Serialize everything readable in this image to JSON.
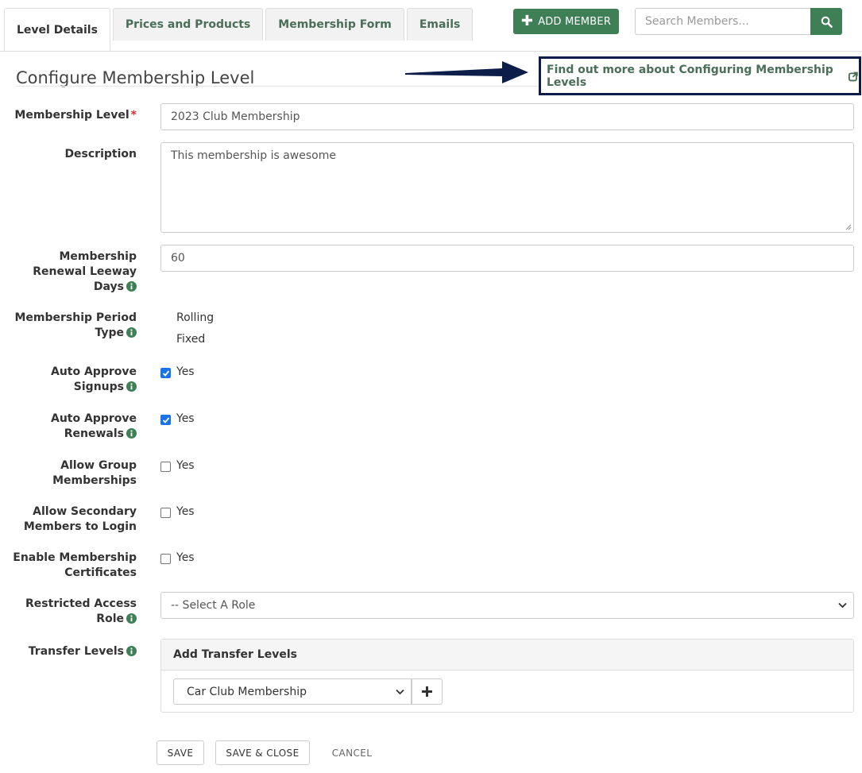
{
  "tabs": [
    {
      "label": "Level Details",
      "active": true
    },
    {
      "label": "Prices and Products"
    },
    {
      "label": "Membership Form"
    },
    {
      "label": "Emails"
    }
  ],
  "header": {
    "add_member_label": "ADD MEMBER",
    "search_placeholder": "Search Members..."
  },
  "page": {
    "title": "Configure Membership Level",
    "help_link": "Find out more about Configuring Membership Levels"
  },
  "form": {
    "membership_level": {
      "label": "Membership Level",
      "required_mark": "*",
      "value": "2023 Club Membership"
    },
    "description": {
      "label": "Description",
      "value": "This membership is awesome"
    },
    "renewal_leeway": {
      "label_line1": "Membership",
      "label_line2": "Renewal Leeway",
      "label_line3": "Days",
      "value": "60"
    },
    "period_type": {
      "label_line1": "Membership Period",
      "label_line2": "Type",
      "options": [
        "Rolling",
        "Fixed"
      ]
    },
    "auto_approve_signups": {
      "label_line1": "Auto Approve",
      "label_line2": "Signups",
      "option": "Yes",
      "checked": true
    },
    "auto_approve_renewals": {
      "label_line1": "Auto Approve",
      "label_line2": "Renewals",
      "option": "Yes",
      "checked": true
    },
    "allow_group": {
      "label_line1": "Allow Group",
      "label_line2": "Memberships",
      "option": "Yes",
      "checked": false
    },
    "allow_secondary": {
      "label_line1": "Allow Secondary",
      "label_line2": "Members to Login",
      "option": "Yes",
      "checked": false
    },
    "enable_certificates": {
      "label_line1": "Enable Membership",
      "label_line2": "Certificates",
      "option": "Yes",
      "checked": false
    },
    "restricted_role": {
      "label_line1": "Restricted Access",
      "label_line2": "Role",
      "selected": "-- Select A Role"
    },
    "transfer_levels": {
      "label": "Transfer Levels",
      "panel_title": "Add Transfer Levels",
      "selected": "Car Club Membership"
    }
  },
  "actions": {
    "save": "SAVE",
    "save_close": "SAVE & CLOSE",
    "cancel": "CANCEL"
  },
  "colors": {
    "brand_green": "#3f7f55",
    "link_green": "#4a6e57",
    "highlight_box": "#0b1d48",
    "checkbox_blue": "#1a73e8"
  },
  "icons": {
    "info": "info-circle-icon",
    "external_link": "external-link-icon",
    "search": "search-icon",
    "add": "plus-icon",
    "dropdown": "chevron-down-icon"
  }
}
